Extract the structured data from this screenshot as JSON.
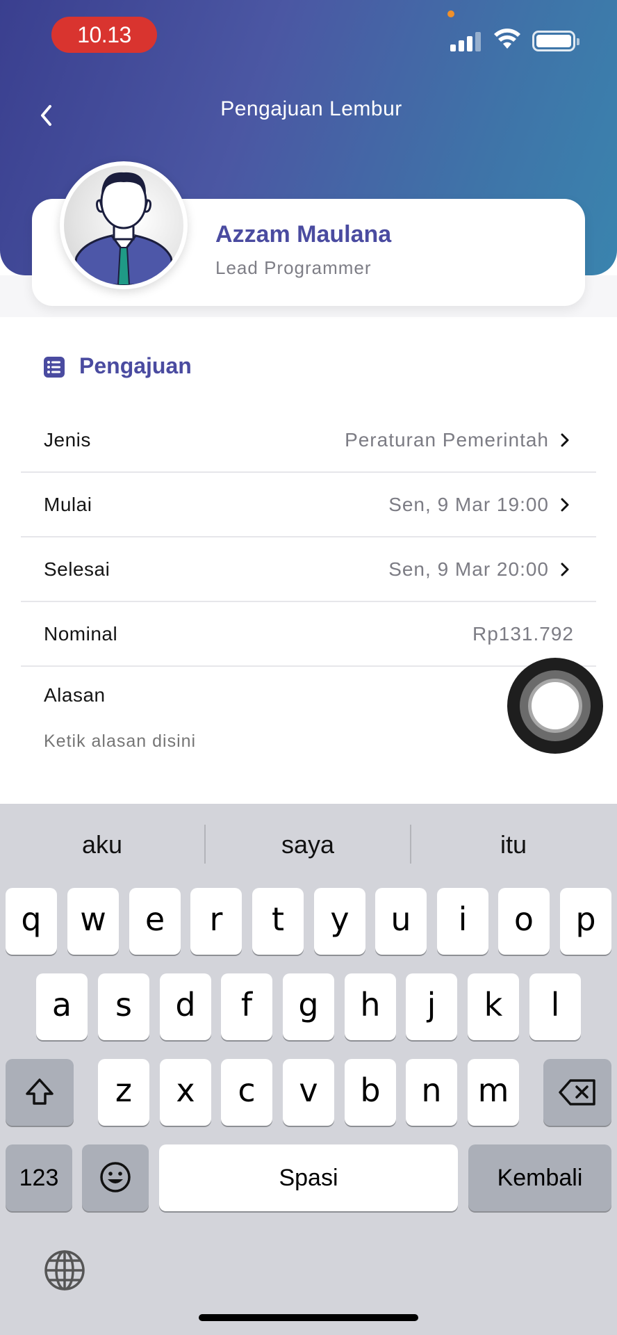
{
  "status_bar": {
    "time": "10.13"
  },
  "nav": {
    "title": "Pengajuan Lembur"
  },
  "profile": {
    "name": "Azzam Maulana",
    "role": "Lead Programmer"
  },
  "section": {
    "title": "Pengajuan"
  },
  "rows": [
    {
      "label": "Jenis",
      "value": "Peraturan Pemerintah"
    },
    {
      "label": "Mulai",
      "value": "Sen, 9 Mar 19:00"
    },
    {
      "label": "Selesai",
      "value": "Sen, 9 Mar 20:00"
    },
    {
      "label": "Nominal",
      "value": "Rp131.792"
    }
  ],
  "reason": {
    "label": "Alasan",
    "placeholder": "Ketik alasan disini"
  },
  "keyboard": {
    "suggestions": [
      "aku",
      "saya",
      "itu"
    ],
    "row1": [
      "q",
      "w",
      "e",
      "r",
      "t",
      "y",
      "u",
      "i",
      "o",
      "p"
    ],
    "row2": [
      "a",
      "s",
      "d",
      "f",
      "g",
      "h",
      "j",
      "k",
      "l"
    ],
    "row3": [
      "z",
      "x",
      "c",
      "v",
      "b",
      "n",
      "m"
    ],
    "numbers_label": "123",
    "space_label": "Spasi",
    "return_label": "Kembali"
  },
  "colors": {
    "accent": "#4a4ba0",
    "header_start": "#3a3f8f",
    "header_end": "#3a84ae",
    "time_pill": "#d9342f"
  }
}
